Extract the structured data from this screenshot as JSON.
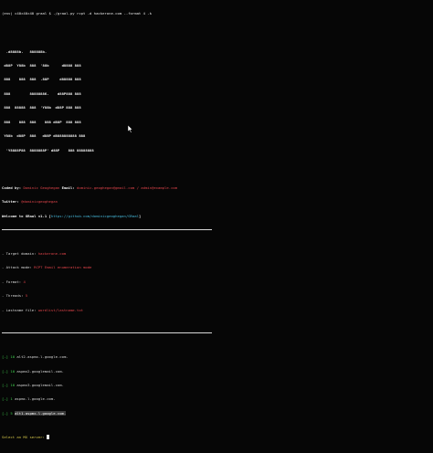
{
  "prompt_line": "(env) ×40×40×40 graal $ ./graal.py rcpt -d hackerone.com --format 4 -k",
  "banner": [
    "  .d8888b.   888888b.",
    " d88P  Y88b  888  '88b      d8888 888",
    " 888    888  888  .88P     d88888 888",
    " 888         8888888K.    d88P888 888",
    " 888  88888  888  'Y88b  d88P 888 888",
    " 888    888  888    888 d88P  888 888",
    " Y88b  d88P  888   d88P d8888888888 888",
    "  'Y8888P88  8888888P' d88P    888 88888888"
  ],
  "credits": {
    "coded_label": "Coded by:",
    "coded_value": "Dominic Geoghegan",
    "email_label": " Email:",
    "email_value": "dominic.geoghegan@gmail.com / admin@example.com",
    "twitter_label": "Twitter:",
    "twitter_value": "@dominicgeoghegan",
    "welcome_text": "Welcome to GRaal v1.1 [",
    "welcome_url": "https://github.com/dominicgeoghegan/GRaal",
    "welcome_end": "]"
  },
  "config": [
    {
      "label": "- Target domain: ",
      "value": "hackerone.com"
    },
    {
      "label": "- Attack mode: ",
      "value": "RCPT Email enumeration mode"
    },
    {
      "label": "- Format: ",
      "value": "4"
    },
    {
      "label": "- Threads: ",
      "value": "5"
    },
    {
      "label": "- Lastname file: ",
      "value": "wordlist/lastname.txt"
    }
  ],
  "servers": [
    {
      "index": "[-] 10 ",
      "host": "alt2.aspmx.l.google.com."
    },
    {
      "index": "[-] 10 ",
      "host": "aspmx2.googlemail.com."
    },
    {
      "index": "[-] 10 ",
      "host": "aspmx3.googlemail.com."
    },
    {
      "index": "[-] 1 ",
      "host": "aspmx.l.google.com."
    },
    {
      "index": "[-] 5 ",
      "host": "alt1.aspmx.l.google.com."
    }
  ],
  "select_prompt": "Select an MX server: "
}
